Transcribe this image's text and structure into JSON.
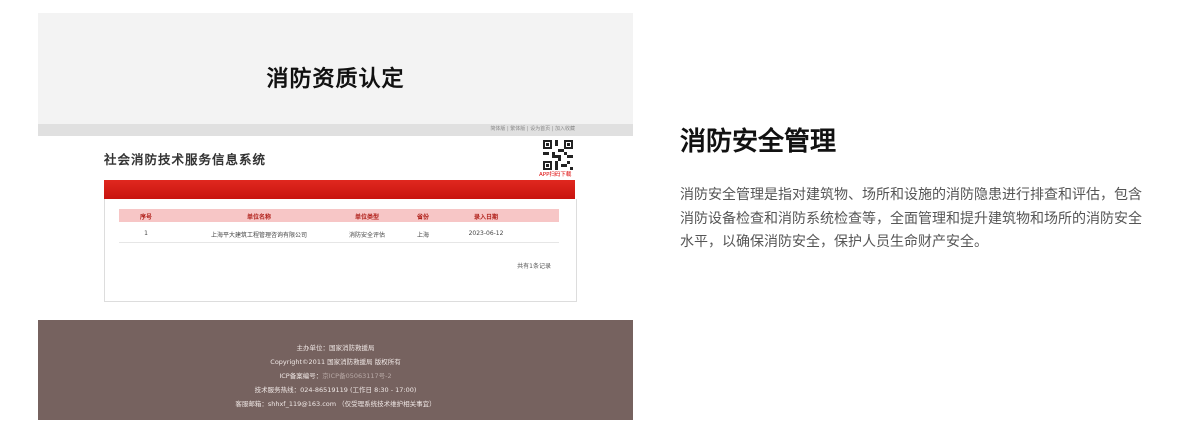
{
  "card": {
    "title": "消防资质认定",
    "topbar_links": "简体版 | 繁体版 | 设为首页 | 加入收藏",
    "system_title": "社会消防技术服务信息系统",
    "app_download": "APP扫码下载",
    "table": {
      "headers": [
        "序号",
        "单位名称",
        "单位类型",
        "省份",
        "录入日期"
      ],
      "rows": [
        [
          "1",
          "上海平大建筑工程管理咨询有限公司",
          "消防安全评估",
          "上海",
          "2023-06-12"
        ]
      ],
      "total": "共有1条记录"
    },
    "footer": {
      "host": "主办单位：国家消防救援局",
      "copyright": "Copyright©2011 国家消防救援局 版权所有",
      "icp_label": "ICP备案编号：",
      "icp_value": "京ICP备05063117号-2",
      "hotline": "技术服务热线：024-86519119 (工作日 8:30 - 17:00)",
      "email": "客服邮箱：shhxf_119@163.com （仅受理系统技术维护相关事宜）"
    },
    "colors": {
      "red_band": "#d21e17",
      "header_pink": "#f7c6c6",
      "footer_bg": "#76625f"
    }
  },
  "description": {
    "title": "消防安全管理",
    "body": "消防安全管理是指对建筑物、场所和设施的消防隐患进行排查和评估，包含消防设备检查和消防系统检查等，全面管理和提升建筑物和场所的消防安全水平，以确保消防安全，保护人员生命财产安全。"
  }
}
